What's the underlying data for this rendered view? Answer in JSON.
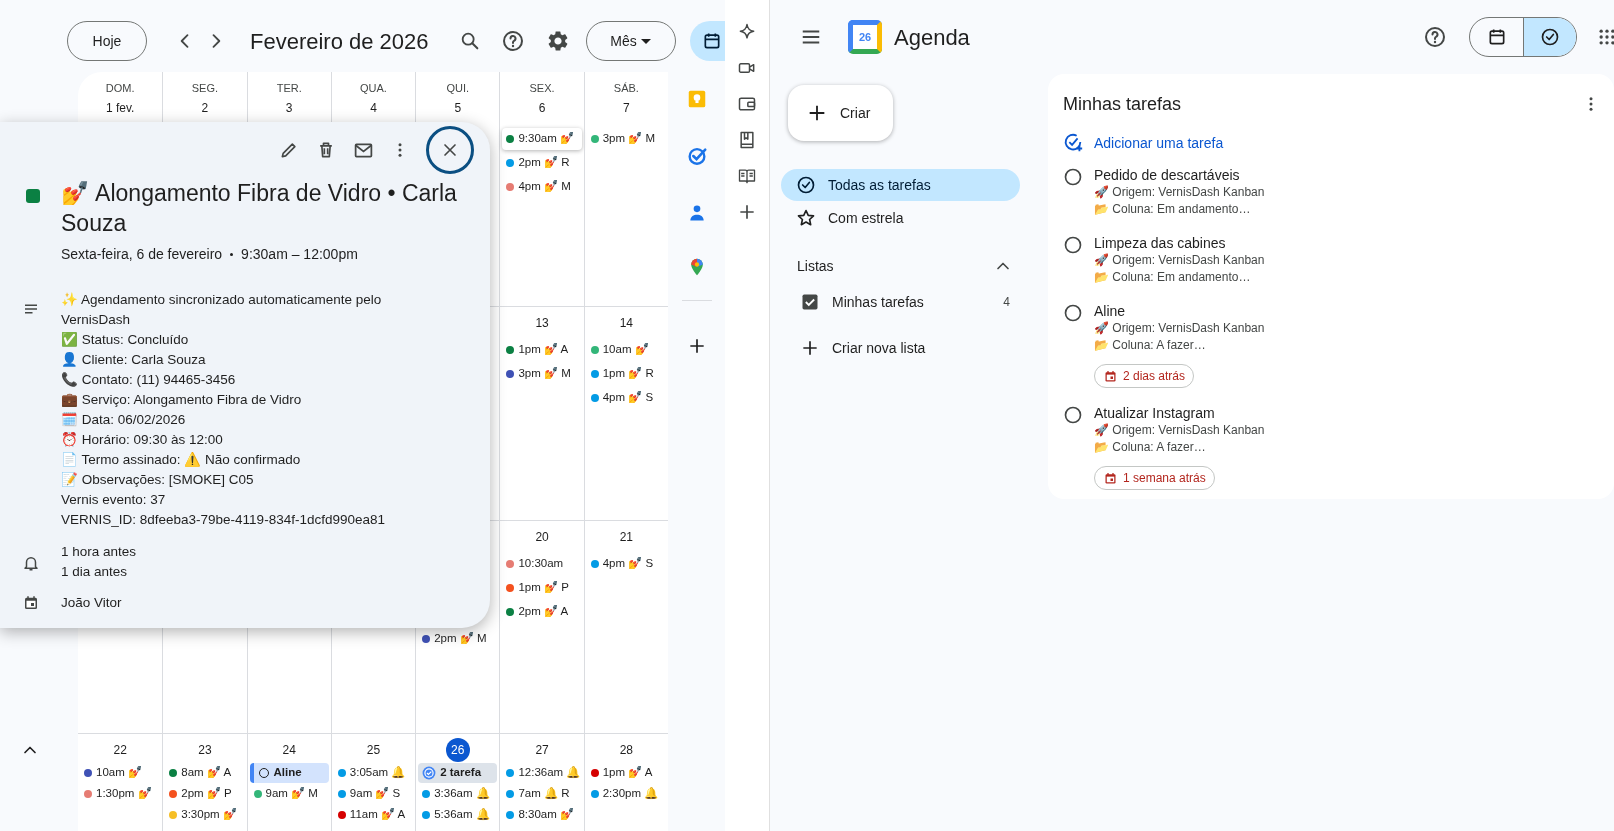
{
  "calendar": {
    "today_button": "Hoje",
    "title": "Fevereiro de 2026",
    "view_button": "Mês",
    "weeks": [
      {
        "cells": [
          {
            "weekday": "DOM.",
            "day": "1 fev.",
            "today": false
          },
          {
            "weekday": "SEG.",
            "day": "2",
            "today": false
          },
          {
            "weekday": "TER.",
            "day": "3",
            "today": false
          },
          {
            "weekday": "QUA.",
            "day": "4",
            "today": false
          },
          {
            "weekday": "QUI.",
            "day": "5",
            "today": false
          },
          {
            "weekday": "SEX.",
            "day": "6",
            "today": false,
            "events": [
              {
                "kind": "event",
                "text": "9:30am 💅",
                "color": "#0b8043",
                "selected": true
              },
              {
                "kind": "event",
                "text": "2pm 💅 R",
                "color": "#039be5",
                "selected": false
              },
              {
                "kind": "event",
                "text": "4pm 💅 M",
                "color": "#e67c73",
                "selected": false
              }
            ]
          },
          {
            "weekday": "SÁB.",
            "day": "7",
            "today": false,
            "events": [
              {
                "kind": "event",
                "text": "3pm 💅 M",
                "color": "#33b679",
                "selected": false
              }
            ]
          }
        ]
      },
      {
        "cells": [
          {},
          {},
          {},
          {},
          {},
          {
            "day": "13",
            "today": false,
            "events": [
              {
                "kind": "event",
                "text": "1pm 💅 A",
                "color": "#0b8043",
                "selected": false
              },
              {
                "kind": "event",
                "text": "3pm 💅 M",
                "color": "#3f51b5",
                "selected": false
              }
            ]
          },
          {
            "day": "14",
            "today": false,
            "events": [
              {
                "kind": "event",
                "text": "10am 💅",
                "color": "#33b679",
                "selected": false
              },
              {
                "kind": "event",
                "text": "1pm 💅 R",
                "color": "#039be5",
                "selected": false
              },
              {
                "kind": "event",
                "text": "4pm 💅 S",
                "color": "#039be5",
                "selected": false
              }
            ]
          }
        ]
      },
      {
        "cells": [
          {},
          {},
          {},
          {},
          {
            "events": [
              {
                "kind": "event",
                "text": "2pm 💅 M",
                "color": "#3f51b5",
                "selected": false
              }
            ]
          },
          {
            "day": "20",
            "today": false,
            "events": [
              {
                "kind": "event",
                "text": "10:30am",
                "color": "#e67c73",
                "selected": false
              },
              {
                "kind": "event",
                "text": "1pm 💅 P",
                "color": "#f4511e",
                "selected": false
              },
              {
                "kind": "event",
                "text": "2pm 💅 A",
                "color": "#0b8043",
                "selected": false
              }
            ]
          },
          {
            "day": "21",
            "today": false,
            "events": [
              {
                "kind": "event",
                "text": "4pm 💅 S",
                "color": "#039be5",
                "selected": false
              }
            ]
          }
        ]
      },
      {
        "cells": [
          {
            "day": "22",
            "today": false,
            "events": [
              {
                "kind": "event",
                "text": "10am 💅",
                "color": "#3f51b5",
                "selected": false
              },
              {
                "kind": "event",
                "text": "1:30pm 💅",
                "color": "#e67c73",
                "selected": false
              }
            ]
          },
          {
            "day": "23",
            "today": false,
            "events": [
              {
                "kind": "event",
                "text": "8am 💅 A",
                "color": "#0b8043",
                "selected": false
              },
              {
                "kind": "event",
                "text": "2pm 💅 P",
                "color": "#f4511e",
                "selected": false
              },
              {
                "kind": "event",
                "text": "3:30pm 💅",
                "color": "#f6bf26",
                "selected": false
              }
            ]
          },
          {
            "day": "24",
            "today": false,
            "events": [
              {
                "kind": "task",
                "text": "Aline",
                "selected": false
              },
              {
                "kind": "event",
                "text": "9am 💅 M",
                "color": "#33b679",
                "selected": false
              }
            ]
          },
          {
            "day": "25",
            "today": false,
            "events": [
              {
                "kind": "event",
                "text": "3:05am 🔔",
                "color": "#039be5",
                "selected": false
              },
              {
                "kind": "event",
                "text": "9am 💅 S",
                "color": "#039be5",
                "selected": false
              },
              {
                "kind": "event",
                "text": "11am 💅 A",
                "color": "#d50000",
                "selected": false
              }
            ]
          },
          {
            "day": "26",
            "today": true,
            "events": [
              {
                "kind": "task_group",
                "text": "2 tarefa",
                "selected": false
              },
              {
                "kind": "event",
                "text": "3:36am 🔔",
                "color": "#039be5",
                "selected": false
              },
              {
                "kind": "event",
                "text": "5:36am 🔔",
                "color": "#039be5",
                "selected": false
              }
            ]
          },
          {
            "day": "27",
            "today": false,
            "events": [
              {
                "kind": "event",
                "text": "12:36am 🔔",
                "color": "#039be5",
                "selected": false
              },
              {
                "kind": "event",
                "text": "7am 🔔 R",
                "color": "#039be5",
                "selected": false
              },
              {
                "kind": "event",
                "text": "8:30am 💅",
                "color": "#039be5",
                "selected": false
              }
            ]
          },
          {
            "day": "28",
            "today": false,
            "events": [
              {
                "kind": "event",
                "text": "1pm 💅 A",
                "color": "#d50000",
                "selected": false
              },
              {
                "kind": "event",
                "text": "2:30pm 🔔",
                "color": "#039be5",
                "selected": false
              }
            ]
          }
        ]
      }
    ]
  },
  "event_popup": {
    "color": "#0b8043",
    "title": "💅 Alongamento Fibra de Vidro • Carla Souza",
    "date": "Sexta-feira, 6 de fevereiro",
    "time": "9:30am – 12:00pm",
    "description": [
      "✨ Agendamento sincronizado automaticamente pelo VernisDash",
      "✅ Status: Concluído",
      "👤 Cliente: Carla Souza",
      "📞 Contato: (11) 94465-3456",
      "💼 Serviço: Alongamento Fibra de Vidro",
      "🗓️ Data: 06/02/2026",
      "⏰ Horário: 09:30 às 12:00",
      "📄 Termo assinado: ⚠️ Não confirmado",
      "📝 Observações: [SMOKE] C05",
      "Vernis evento: 37",
      "VERNIS_ID: 8dfeeba3-79be-4119-834f-1dcfd990ea81"
    ],
    "reminders": [
      "1 hora antes",
      "1 dia antes"
    ],
    "calendar": "João Vitor"
  },
  "tasks_app": {
    "logo_day": "26",
    "title": "Agenda",
    "view_toggle": [
      {
        "kind": "calendar",
        "selected": false
      },
      {
        "kind": "tasks",
        "selected": true
      }
    ],
    "create_button": "Criar",
    "nav": [
      {
        "kind": "all",
        "label": "Todas as tarefas",
        "selected": true
      },
      {
        "kind": "starred",
        "label": "Com estrela",
        "selected": false
      }
    ],
    "lists_header": "Listas",
    "lists_expanded": true,
    "lists": [
      {
        "label": "Minhas tarefas",
        "count": "4",
        "checked": true
      }
    ],
    "new_list": "Criar nova lista",
    "panel": {
      "title": "Minhas tarefas",
      "add_task": "Adicionar uma tarefa",
      "tasks": [
        {
          "title": "Pedido de descartáveis",
          "origin": "🚀 Origem: VernisDash Kanban",
          "column": "📂 Coluna: Em andamento…",
          "done": false
        },
        {
          "title": "Limpeza das cabines",
          "origin": "🚀 Origem: VernisDash Kanban",
          "column": "📂 Coluna: Em andamento…",
          "done": false
        },
        {
          "title": "Aline",
          "origin": "🚀 Origem: VernisDash Kanban",
          "column": "📂 Coluna: A fazer…",
          "due": "2 dias atrás",
          "done": false
        },
        {
          "title": "Atualizar Instagram",
          "origin": "🚀 Origem: VernisDash Kanban",
          "column": "📂 Coluna: A fazer…",
          "due": "1 semana atrás",
          "done": false
        }
      ]
    }
  }
}
